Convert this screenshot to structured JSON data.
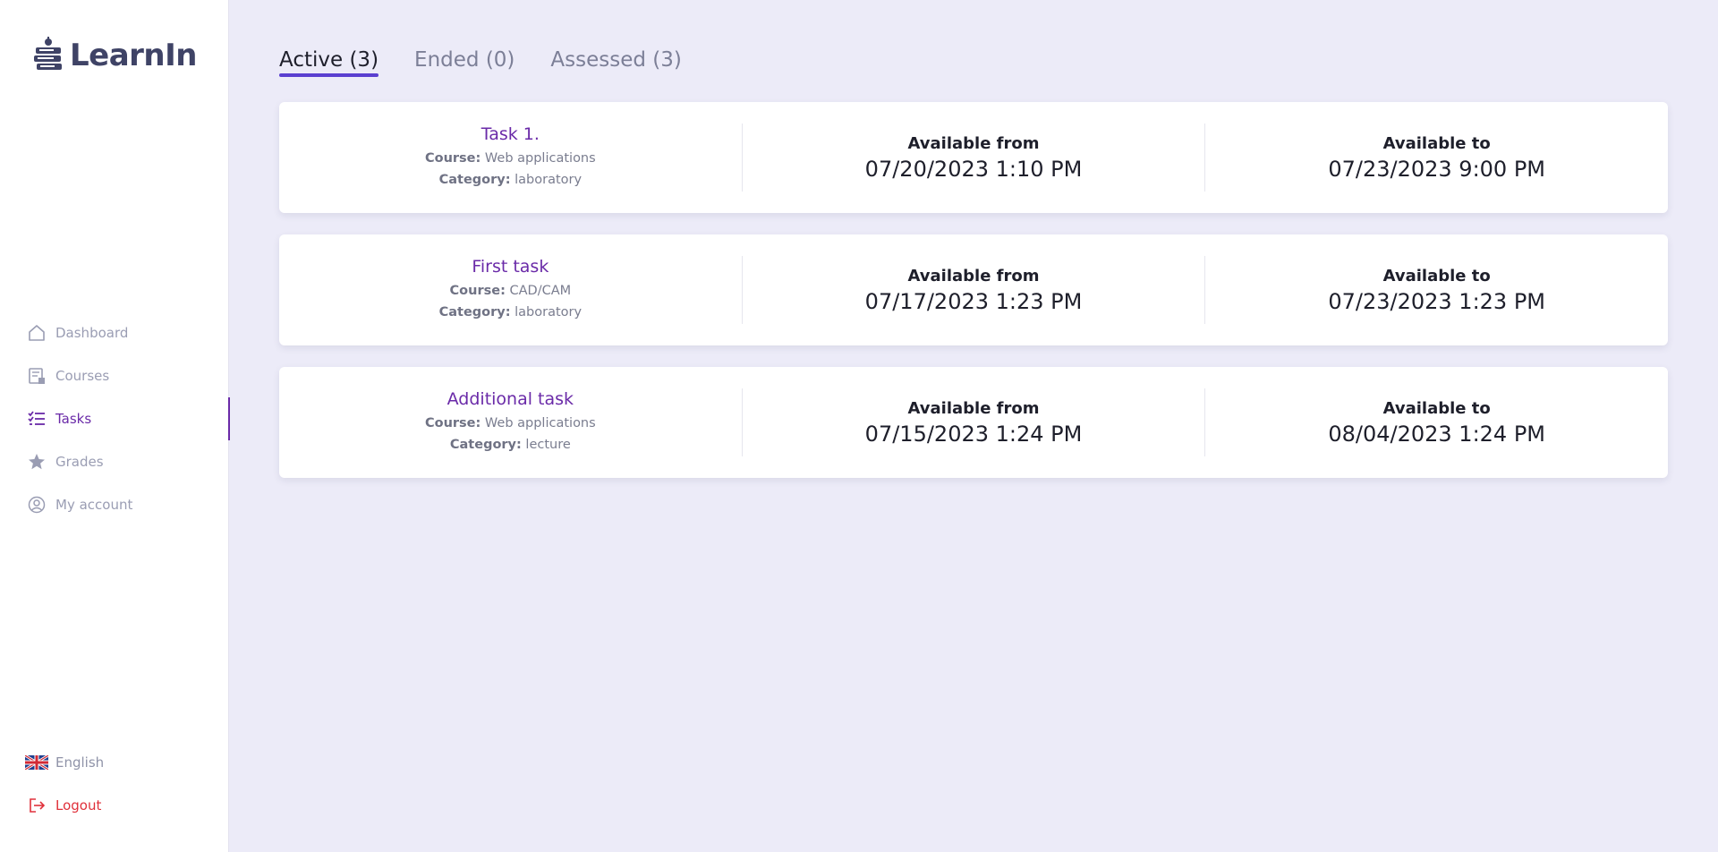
{
  "app": {
    "name": "LearnIn"
  },
  "sidebar": {
    "items": [
      {
        "label": "Dashboard",
        "icon": "home-icon"
      },
      {
        "label": "Courses",
        "icon": "courses-icon"
      },
      {
        "label": "Tasks",
        "icon": "tasks-icon",
        "active": true
      },
      {
        "label": "Grades",
        "icon": "star-icon"
      },
      {
        "label": "My account",
        "icon": "user-circle-icon"
      }
    ],
    "language": {
      "label": "English",
      "icon": "uk-flag-icon"
    },
    "logout": {
      "label": "Logout",
      "icon": "logout-icon"
    }
  },
  "tabs": [
    {
      "label": "Active (3)",
      "active": true
    },
    {
      "label": "Ended (0)"
    },
    {
      "label": "Assessed (3)"
    }
  ],
  "labels": {
    "course": "Course:",
    "category": "Category:",
    "available_from": "Available from",
    "available_to": "Available to"
  },
  "tasks": [
    {
      "title": "Task 1.",
      "course": "Web applications",
      "category": "laboratory",
      "available_from": "07/20/2023 1:10 PM",
      "available_to": "07/23/2023 9:00 PM"
    },
    {
      "title": "First task",
      "course": "CAD/CAM",
      "category": "laboratory",
      "available_from": "07/17/2023 1:23 PM",
      "available_to": "07/23/2023 1:23 PM"
    },
    {
      "title": "Additional task",
      "course": "Web applications",
      "category": "lecture",
      "available_from": "07/15/2023 1:24 PM",
      "available_to": "08/04/2023 1:24 PM"
    }
  ],
  "colors": {
    "accent": "#6a2aa8",
    "tab_underline": "#5a3fd0",
    "logout": "#e0313b",
    "background": "#ecebf8"
  }
}
